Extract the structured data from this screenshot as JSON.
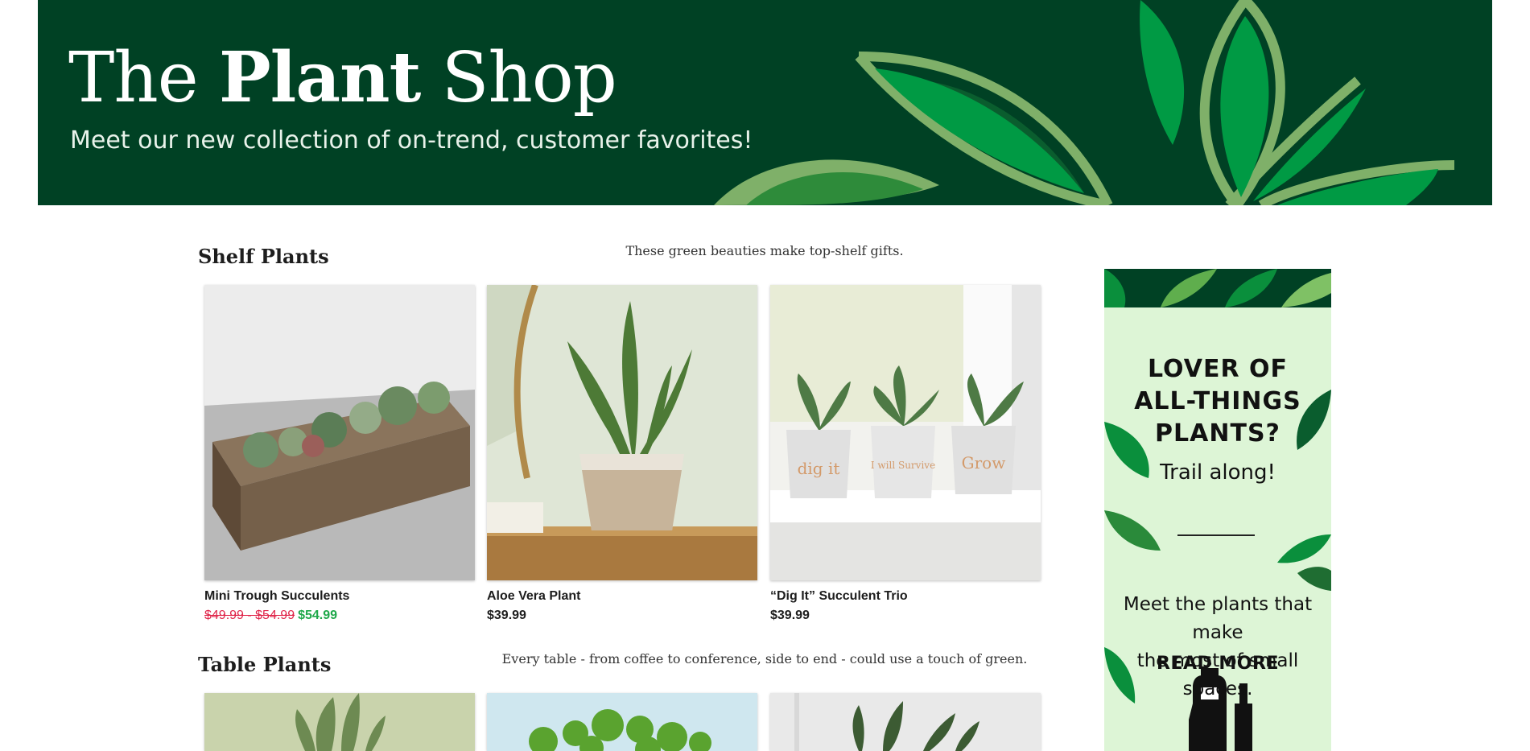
{
  "hero": {
    "title_pre": "The ",
    "title_bold": "Plant",
    "title_post": " Shop",
    "subtitle": "Meet our new collection of on-trend, customer favorites!"
  },
  "sections": [
    {
      "title": "Shelf Plants",
      "description": "These green beauties make top-shelf gifts.",
      "products": [
        {
          "name": "Mini Trough Succulents",
          "old_price": "$49.99 - $54.99",
          "price": "$54.99"
        },
        {
          "name": "Aloe Vera Plant",
          "price": "$39.99"
        },
        {
          "name": "“Dig It” Succulent Trio",
          "price": "$39.99"
        }
      ]
    },
    {
      "title": "Table Plants",
      "description": "Every table - from coffee to conference, side to end - could use a touch of green."
    }
  ],
  "pot_labels": [
    "dig it",
    "I will Survive",
    "Grow"
  ],
  "ad": {
    "headline_1": "LOVER OF",
    "headline_2": "ALL-THINGS",
    "headline_3": "PLANTS?",
    "trail": "Trail along!",
    "body_1": "Meet the plants that make",
    "body_2": "the most of small spaces.",
    "cta": "READ MORE"
  },
  "colors": {
    "hero_bg": "#004124",
    "leaf_light": "#7fb069",
    "leaf_bright": "#009a44",
    "ad_bg": "#ddf5d6",
    "sale_price": "#1fa84a",
    "old_price": "#e0254a"
  }
}
